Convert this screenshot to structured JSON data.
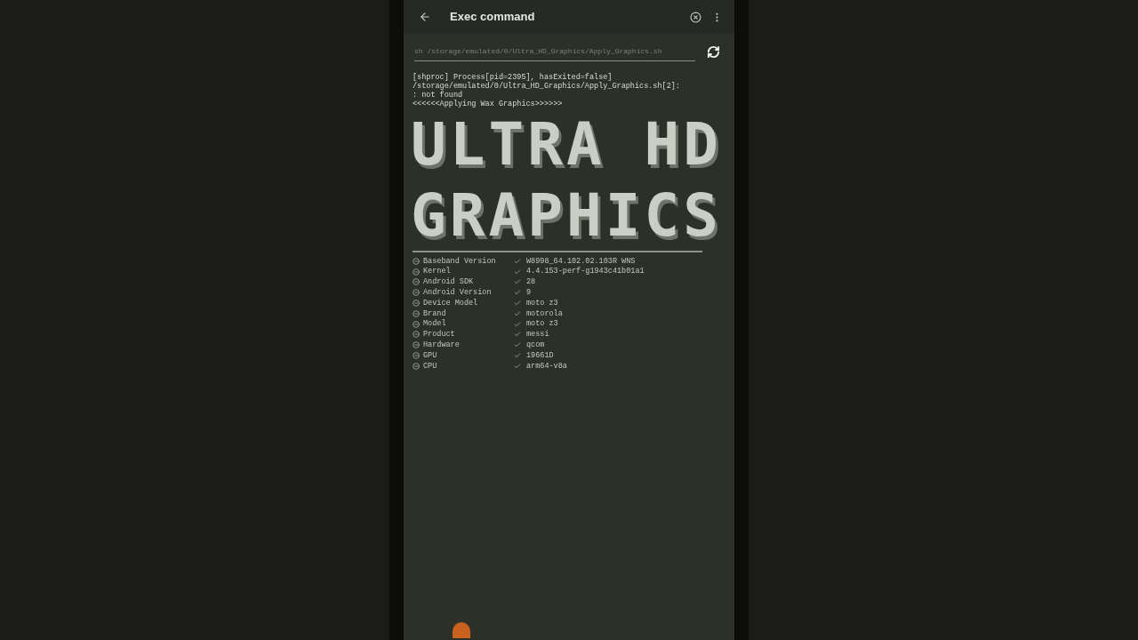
{
  "app_bar": {
    "title": "Exec command"
  },
  "command_field": {
    "placeholder": "sh /storage/emulated/0/Ultra_HD_Graphics/Apply_Graphics.sh"
  },
  "output_lines": [
    "[shproc] Process[pid=2395], hasExited=false]",
    "/storage/emulated/0/Ultra_HD_Graphics/Apply_Graphics.sh[2]:",
    ": not found",
    "<<<<<<Applying Wax Graphics>>>>>>"
  ],
  "banner_lines": [
    "ULTRA HD",
    "GRAPHICS"
  ],
  "info_rows": [
    {
      "label": "Baseband Version",
      "value": "W8998_64.102.02.103R WNS"
    },
    {
      "label": "Kernel",
      "value": "4.4.153-perf-g1943c41b01a1"
    },
    {
      "label": "Android SDK",
      "value": "28"
    },
    {
      "label": "Android Version",
      "value": "9"
    },
    {
      "label": "Device Model",
      "value": "moto z3"
    },
    {
      "label": "Brand",
      "value": "motorola"
    },
    {
      "label": "Model",
      "value": "moto z3"
    },
    {
      "label": "Product",
      "value": "messi"
    },
    {
      "label": "Hardware",
      "value": "qcom"
    },
    {
      "label": "GPU",
      "value": "19661D"
    },
    {
      "label": "CPU",
      "value": "arm64-v8a"
    }
  ]
}
